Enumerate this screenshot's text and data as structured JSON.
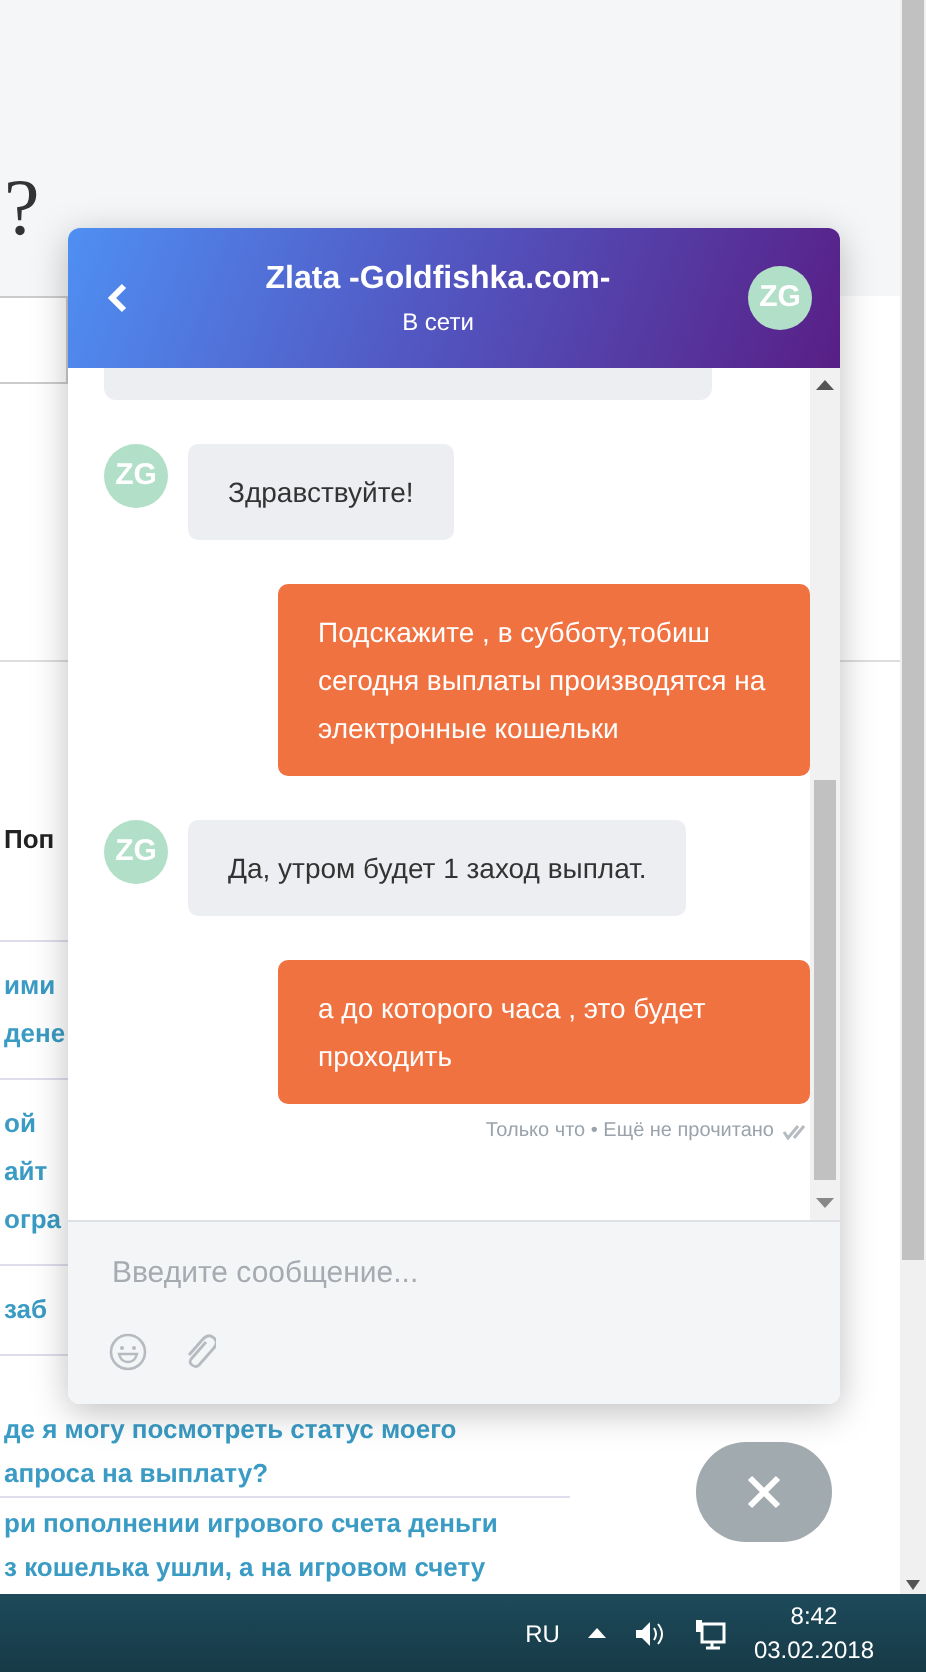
{
  "page": {
    "heading": "?",
    "section_title": "Поп",
    "faq": [
      {
        "lines": [
          "ими",
          "дене"
        ]
      },
      {
        "lines": [
          "ой",
          "айт",
          "огра"
        ]
      },
      {
        "lines": [
          "заб"
        ]
      },
      {
        "lines": [
          "де я могу посмотреть статус моего",
          "апроса на выплату?"
        ]
      },
      {
        "lines": [
          "ри пополнении игрового счета деньги",
          "з кошелька ушли, а на игровом счету"
        ]
      }
    ]
  },
  "chat": {
    "title": "Zlata -Goldfishka.com-",
    "status": "В сети",
    "avatar": "ZG",
    "messages": [
      {
        "kind": "cut"
      },
      {
        "kind": "agent",
        "avatar": "ZG",
        "text": "Здравствуйте!"
      },
      {
        "kind": "user",
        "text": "Подскажите , в субботу,тобиш сегодня выплаты производятся на электронные кошельки"
      },
      {
        "kind": "agent",
        "avatar": "ZG",
        "text": "Да, утром будет 1 заход выплат."
      },
      {
        "kind": "user",
        "text": "а до которого часа , это будет проходить"
      }
    ],
    "receipt": "Только что • Ещё не прочитано",
    "composer": {
      "placeholder": "Введите сообщение..."
    }
  },
  "taskbar": {
    "language": "RU",
    "time": "8:42",
    "date": "03.02.2018"
  }
}
